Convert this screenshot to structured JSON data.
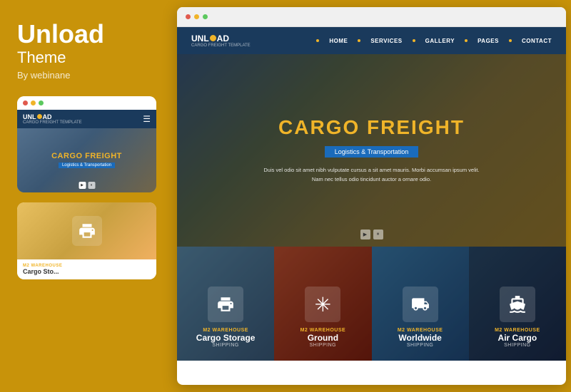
{
  "brand": {
    "title": "Unload",
    "subtitle": "Theme",
    "by": "By webinane"
  },
  "mobile_preview": {
    "logo": "UNL",
    "logo_suffix": "AD",
    "logo_sub": "CARGO FREIGHT TEMPLATE",
    "hero_title": "CARGO FREIGHT",
    "hero_subtitle": "Logistics & Transportation",
    "controls": [
      ">",
      "||"
    ]
  },
  "mobile_service": {
    "tag": "M2 Warehouse",
    "title": "Cargo Sto..."
  },
  "desktop": {
    "nav": {
      "logo": "UNL",
      "logo_suffix": "AD",
      "logo_sub": "CARGO FREIGHT TEMPLATE",
      "links": [
        "HOME",
        "SERVICES",
        "GALLERY",
        "PAGES",
        "CONTACT"
      ]
    },
    "hero": {
      "title": "CARGO FREIGHT",
      "badge": "Logistics & Transportation",
      "text": "Duis vel odio sit amet nibh vulputate cursus a sit amet mauris. Morbi accumsan ipsum velit. Nam nec tellus odio tincidunt auctor a ornare odio.",
      "controls": [
        ">",
        "||"
      ]
    },
    "services": [
      {
        "tag": "M2 Warehouse",
        "title": "Cargo Storage",
        "sub": "SHIPPING",
        "icon": "print"
      },
      {
        "tag": "M2 Warehouse",
        "title": "Ground",
        "sub": "SHIPPING",
        "icon": "asterisk"
      },
      {
        "tag": "M2 Warehouse",
        "title": "Worldwide",
        "sub": "SHIPPING",
        "icon": "truck"
      },
      {
        "tag": "M2 Warehouse",
        "title": "Air Cargo",
        "sub": "SHIPPING",
        "icon": "ship"
      }
    ]
  },
  "browser_dots": {
    "colors": [
      "#e05a4e",
      "#f0b429",
      "#5cc85e"
    ]
  }
}
